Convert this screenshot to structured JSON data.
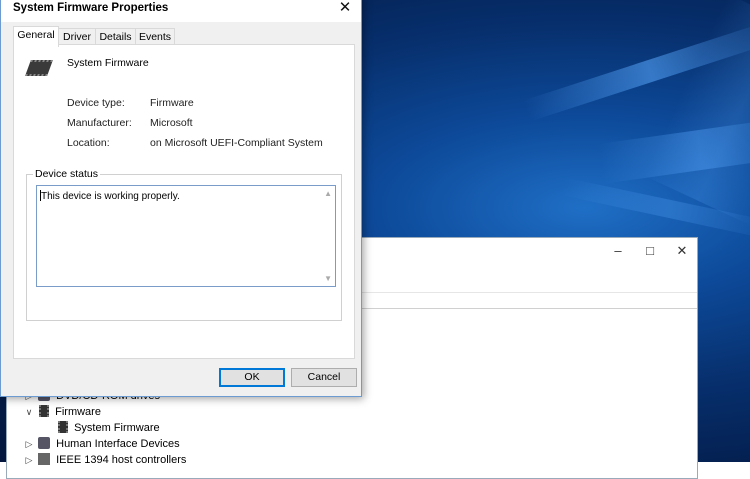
{
  "dialog": {
    "title": "System Firmware Properties",
    "tabs": [
      {
        "label": "General"
      },
      {
        "label": "Driver"
      },
      {
        "label": "Details"
      },
      {
        "label": "Events"
      }
    ],
    "device_name": "System Firmware",
    "properties": [
      {
        "label": "Device type:",
        "value": "Firmware"
      },
      {
        "label": "Manufacturer:",
        "value": "Microsoft"
      },
      {
        "label": "Location:",
        "value": "on Microsoft UEFI-Compliant System"
      }
    ],
    "status_group_label": "Device status",
    "status_text": "This device is working properly.",
    "ok_label": "OK",
    "cancel_label": "Cancel"
  },
  "device_manager": {
    "tree": [
      {
        "label": "DVD/CD-ROM drives",
        "expanded": false
      },
      {
        "label": "Firmware",
        "expanded": true
      },
      {
        "label": "System Firmware",
        "child": true
      },
      {
        "label": "Human Interface Devices",
        "expanded": false
      },
      {
        "label": "IEEE 1394 host controllers",
        "expanded": false
      }
    ]
  },
  "colors": {
    "accent": "#0078d7",
    "desktop": "#07306e"
  }
}
